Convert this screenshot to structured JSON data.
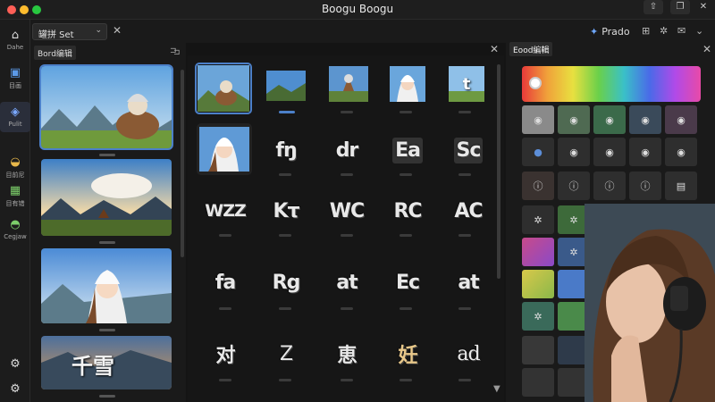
{
  "window": {
    "title": "Boogu Boogu"
  },
  "toolbar": {
    "set_select": "罐拼 Set",
    "right_label": "Prado"
  },
  "nav": [
    {
      "icon": "home-icon",
      "label": "Dahe"
    },
    {
      "icon": "board-icon",
      "label": "目画"
    },
    {
      "icon": "rocket-icon",
      "label": "Pulit"
    },
    {
      "icon": "bowl-icon",
      "label": "目前尼"
    },
    {
      "icon": "gift-icon",
      "label": "目有错"
    },
    {
      "icon": "pot-icon",
      "label": "Cegjaw"
    }
  ],
  "board_panel": {
    "title": "Bord编辑",
    "thumbs": [
      "mountain-figure",
      "sunset-huts",
      "anime-girl",
      "千雪"
    ]
  },
  "grid_panel": {
    "rows": [
      [
        "img:figure",
        "img:landscape",
        "img:house",
        "img:girl",
        "t"
      ],
      [
        "img:girl2",
        "fŋ",
        "dr",
        "Ea",
        "Sc"
      ],
      [
        "WZZ",
        "Kτ",
        "WC",
        "RC",
        "AC"
      ],
      [
        "fa",
        "Rg",
        "at",
        "Ec",
        "at"
      ],
      [
        "对",
        "Z",
        "恵",
        "妊",
        "ad"
      ]
    ]
  },
  "swatch_panel": {
    "title": "Eood編輯"
  },
  "colors": {
    "accent": "#4c80c9",
    "bg": "#141414"
  }
}
